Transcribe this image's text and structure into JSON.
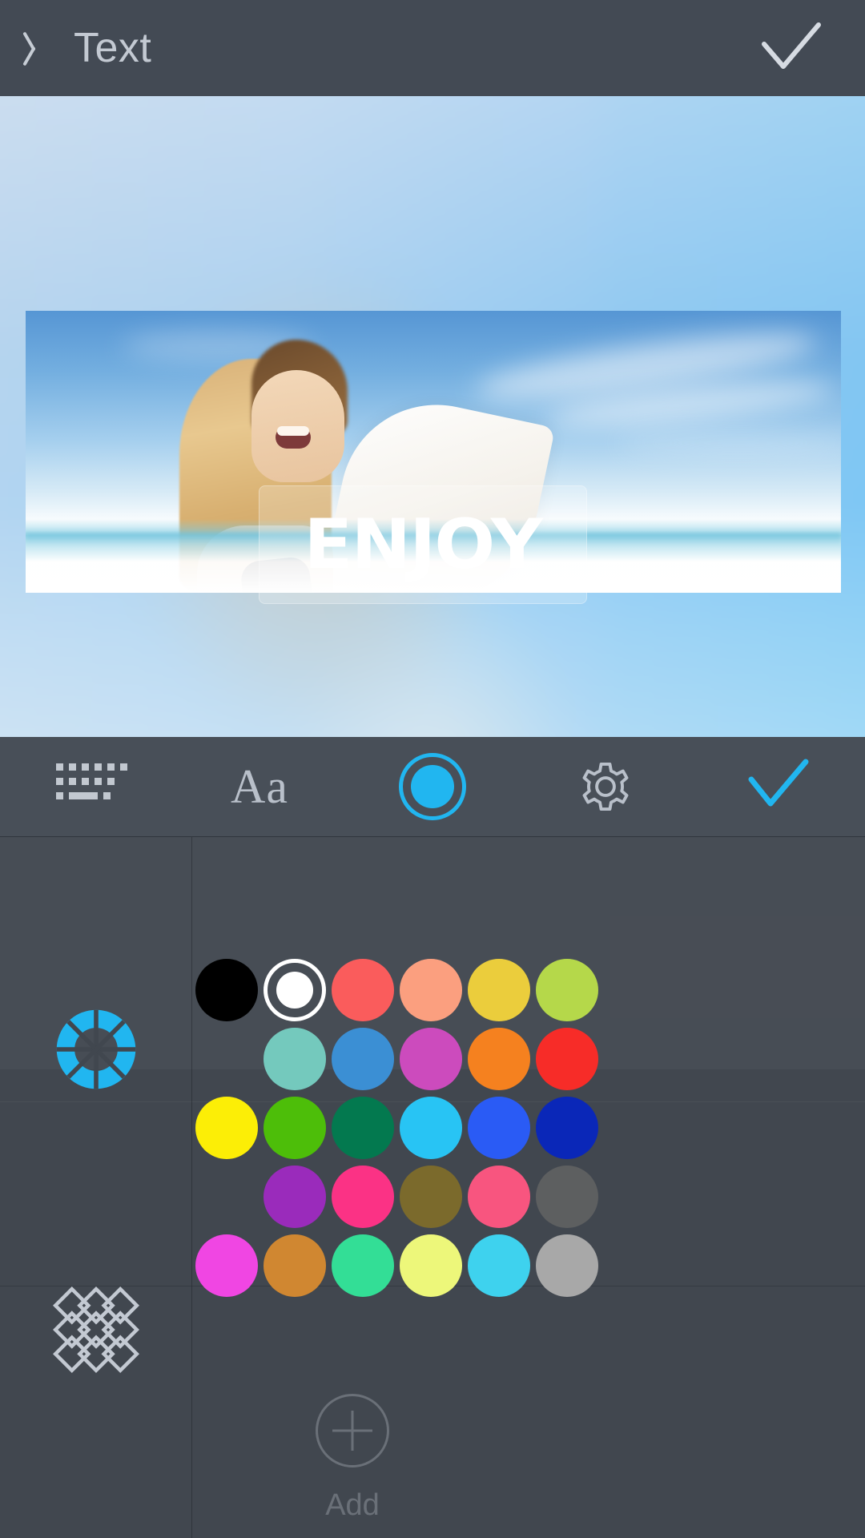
{
  "topbar": {
    "back_icon": "chevron-left-icon",
    "title": "Text",
    "confirm_icon": "check-icon"
  },
  "canvas": {
    "text_object": {
      "value": "ENJOY",
      "color": "#ffffff",
      "box_fill": "rgba(255,255,255,0.22)"
    }
  },
  "toolbar": {
    "items": [
      {
        "name": "keyboard",
        "icon": "keyboard-icon",
        "label": "",
        "active": false
      },
      {
        "name": "font",
        "icon": "font-aa-icon",
        "label": "Aa",
        "active": false
      },
      {
        "name": "color",
        "icon": "color-circle-icon",
        "label": "",
        "active": true
      },
      {
        "name": "settings",
        "icon": "gear-icon",
        "label": "",
        "active": false
      },
      {
        "name": "done",
        "icon": "check-icon",
        "label": "",
        "active": false
      }
    ],
    "accent": "#21b6f0"
  },
  "panel": {
    "sidebar": [
      {
        "name": "color-wheel",
        "icon": "color-wheel-icon",
        "active": true,
        "color": "#21b6f0"
      },
      {
        "name": "pattern",
        "icon": "diamond-lattice-icon",
        "active": false,
        "color": "#c3c9d2"
      }
    ],
    "add_button": {
      "label": "Add",
      "icon": "plus-circle-icon"
    },
    "selected_color": "#ffffff",
    "swatch_rows": [
      {
        "indent": false,
        "colors": [
          "#000000",
          "#ffffff",
          "#fa5c5c",
          "#fb9f7f",
          "#ebcd3c",
          "#b5d84a"
        ]
      },
      {
        "indent": true,
        "colors": [
          "#74c9bd",
          "#3b8fd4",
          "#cc4bbd",
          "#f5811f",
          "#f72c28"
        ]
      },
      {
        "indent": false,
        "colors": [
          "#fcee06",
          "#4dbe09",
          "#03794f",
          "#28c4f4",
          "#2a5bf5",
          "#0a27b8"
        ]
      },
      {
        "indent": true,
        "colors": [
          "#9a2bbb",
          "#fb3285",
          "#7b6a2c",
          "#f8557f",
          "#5d5f60"
        ]
      },
      {
        "indent": false,
        "colors": [
          "#f046e3",
          "#d08731",
          "#33de96",
          "#edf77a",
          "#3ed2ee",
          "#a8a8a8"
        ]
      }
    ]
  }
}
